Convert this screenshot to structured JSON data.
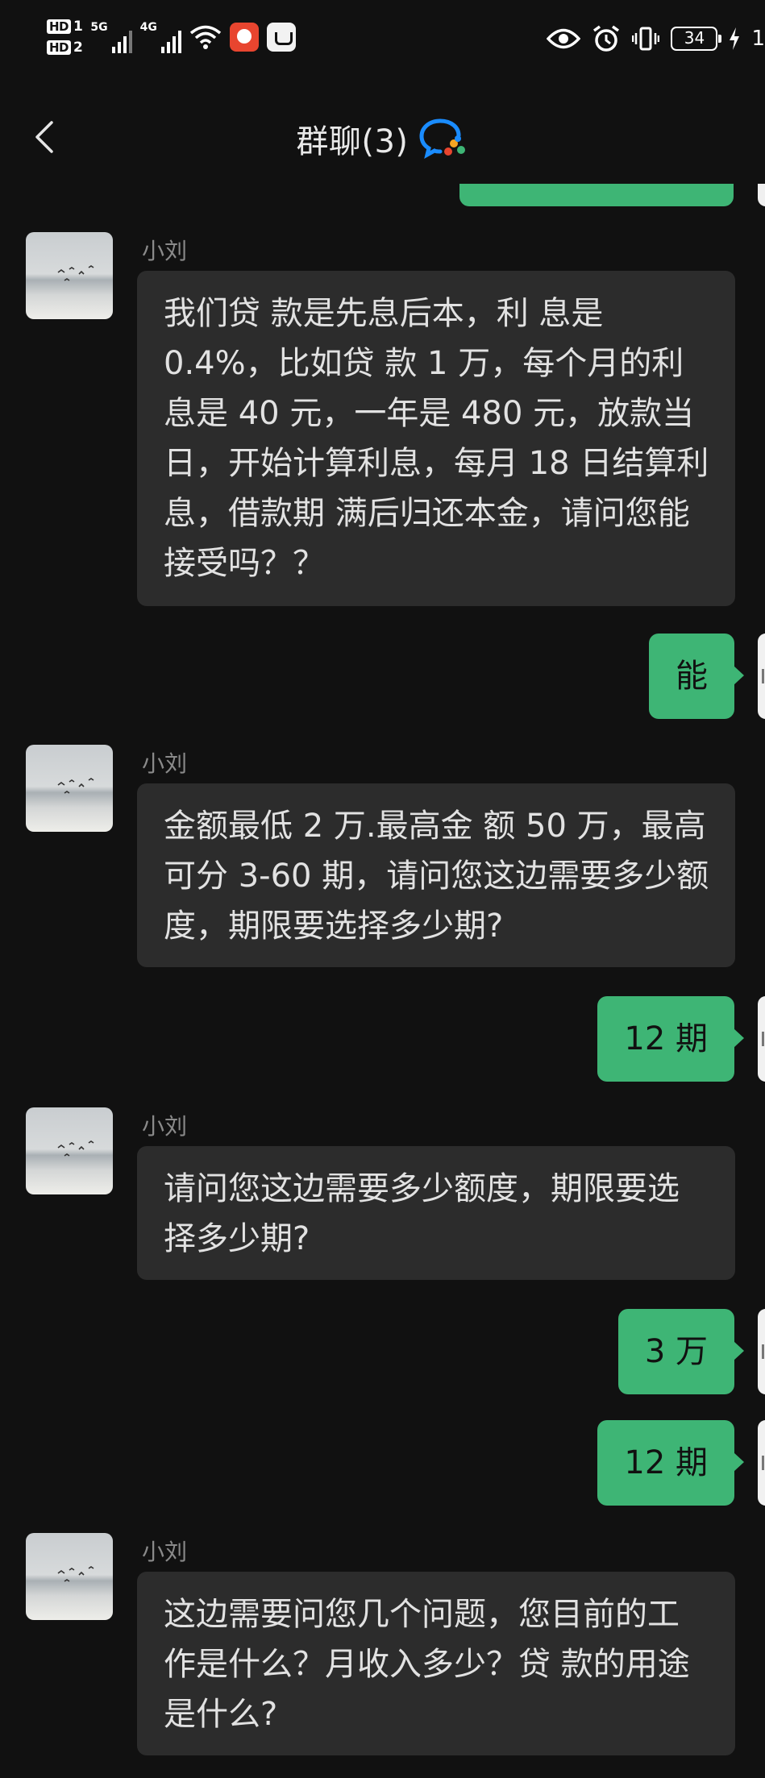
{
  "status_bar": {
    "sim1": "HD",
    "sim1_num": "1",
    "sim2": "HD",
    "sim2_num": "2",
    "net1": "5G",
    "net2": "4G",
    "battery": "34",
    "clock_partial": "1"
  },
  "nav": {
    "title": "群聊(3)",
    "back_icon": "chevron-left-icon",
    "badge_icon": "wecom-chat-icon"
  },
  "colors": {
    "background": "#111111",
    "incoming_bubble": "#2c2c2c",
    "outgoing_bubble": "#3eb575",
    "sender_name": "#8a8a8a"
  },
  "messages": [
    {
      "direction": "in",
      "sender": "小刘",
      "text": "我们贷 款是先息后本，利 息是0.4%，比如贷 款 1 万，每个月的利息是 40 元，一年是 480 元，放款当日，开始计算利息，每月 18 日结算利息，借款期 满后归还本金，请问您能接受吗？？"
    },
    {
      "direction": "out",
      "text": "能"
    },
    {
      "direction": "in",
      "sender": "小刘",
      "text": "金额最低 2 万.最高金 额 50 万，最高可分 3-60 期，请问您这边需要多少额度，期限要选择多少期?"
    },
    {
      "direction": "out",
      "text": "12 期"
    },
    {
      "direction": "in",
      "sender": "小刘",
      "text": "请问您这边需要多少额度，期限要选择多少期?"
    },
    {
      "direction": "out",
      "text": "3 万"
    },
    {
      "direction": "out",
      "text": "12 期"
    },
    {
      "direction": "in",
      "sender": "小刘",
      "text": "这边需要问您几个问题，您目前的工作是什么？月收入多少？贷 款的用途是什么?"
    }
  ]
}
